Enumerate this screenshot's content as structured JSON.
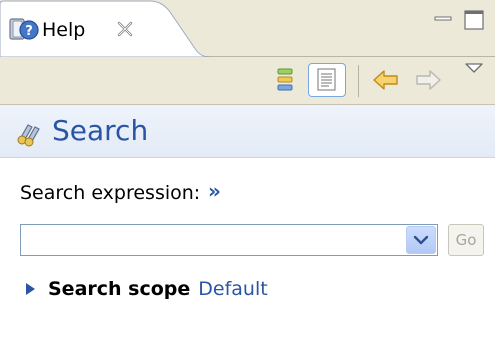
{
  "view_tab": {
    "label": "Help",
    "icon": "help-book-icon"
  },
  "window_controls": {
    "minimize_icon": "minimize-icon",
    "maximize_icon": "maximize-icon"
  },
  "toolbar": {
    "buttons": [
      {
        "icon": "show-all-topics-icon"
      },
      {
        "icon": "show-in-all-topics-toggled-icon"
      },
      {
        "icon": "back-arrow-icon"
      },
      {
        "icon": "forward-arrow-icon"
      },
      {
        "icon": "view-menu-icon"
      }
    ]
  },
  "search_header": {
    "title": "Search",
    "icon": "search-binoculars-icon"
  },
  "search_expression": {
    "label": "Search expression:",
    "more_link": "»",
    "value": "",
    "placeholder": ""
  },
  "go_button": {
    "label": "Go",
    "enabled": false
  },
  "search_scope": {
    "label": "Search scope",
    "value": "Default"
  },
  "colors": {
    "title_blue": "#2a55a3",
    "tab_strip": "#ece9d8",
    "header_bg": "#e3ebf7"
  }
}
